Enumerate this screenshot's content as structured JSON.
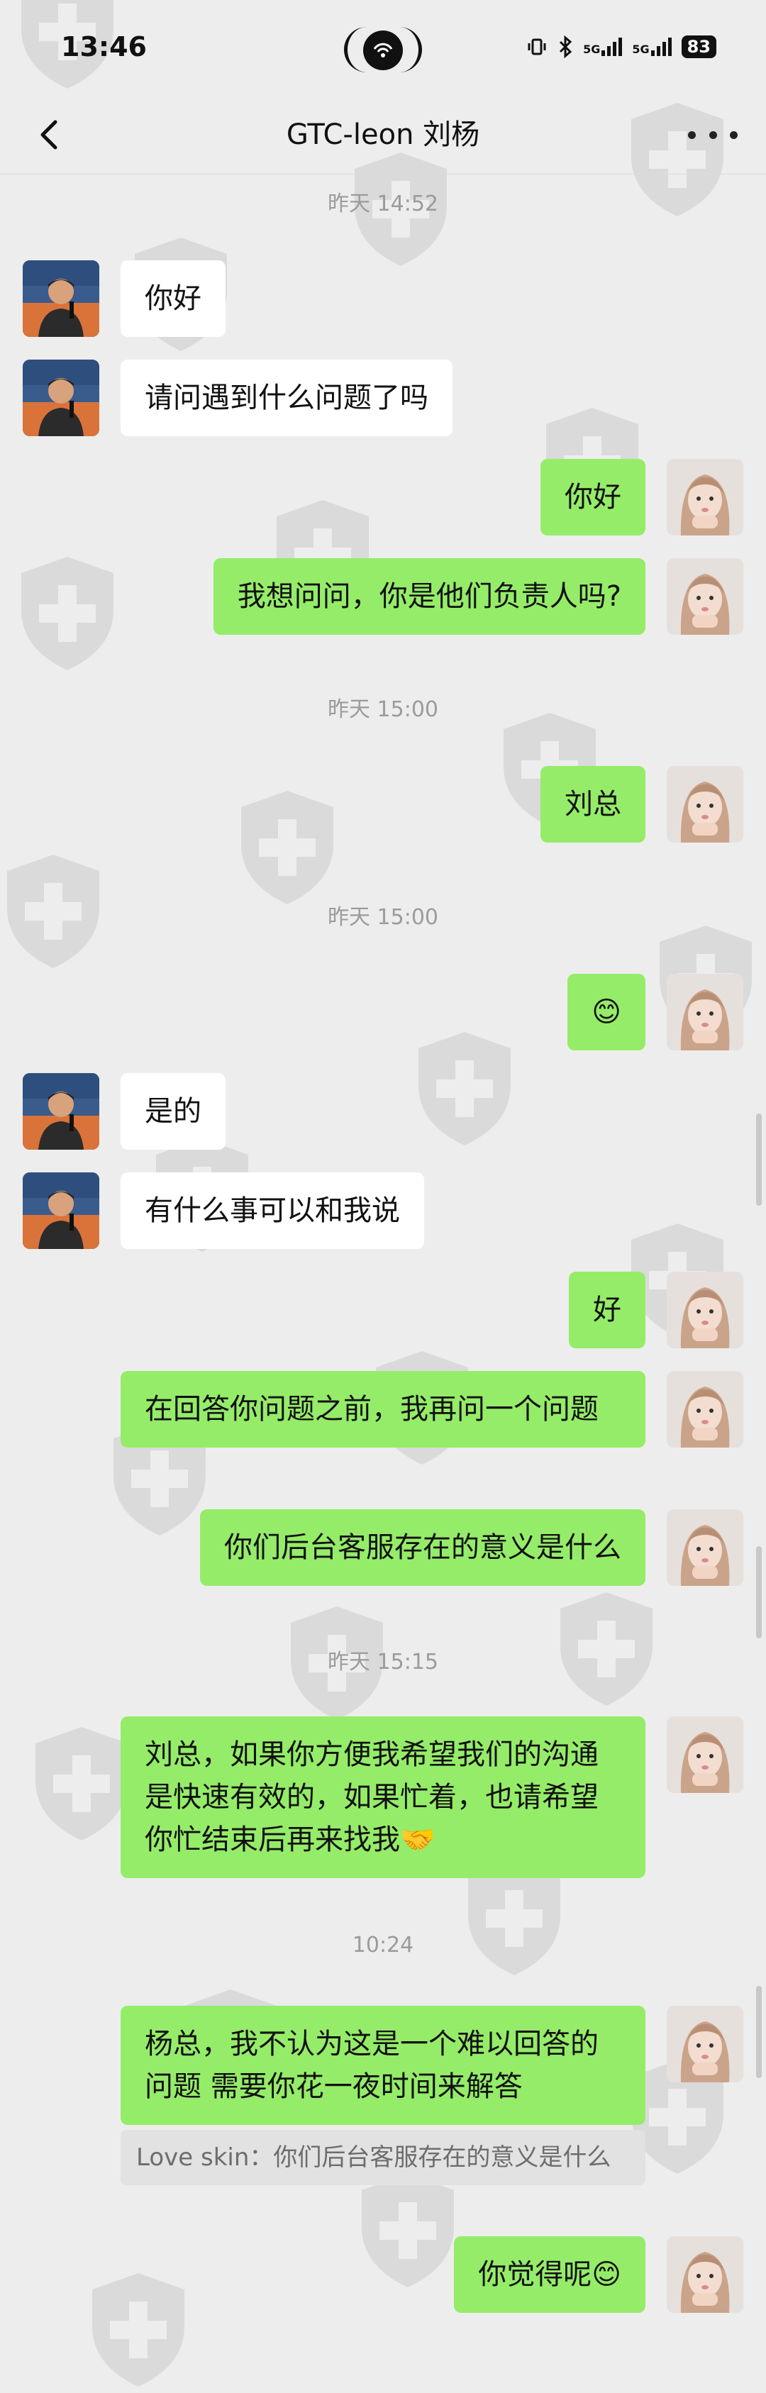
{
  "status": {
    "time": "13:46",
    "signal1": "5G",
    "signal2": "5G",
    "battery": "83"
  },
  "header": {
    "title": "GTC-leon 刘杨"
  },
  "timestamps": [
    "昨天 14:52",
    "昨天 15:00",
    "昨天 15:00",
    "昨天 15:15",
    "10:24"
  ],
  "messages": [
    {
      "side": "in",
      "text": "你好"
    },
    {
      "side": "in",
      "text": "请问遇到什么问题了吗"
    },
    {
      "side": "out",
      "text": "你好"
    },
    {
      "side": "out",
      "text": "我想问问，你是他们负责人吗?"
    },
    {
      "side": "out",
      "text": "刘总"
    },
    {
      "side": "out",
      "text": "😊"
    },
    {
      "side": "in",
      "text": "是的"
    },
    {
      "side": "in",
      "text": "有什么事可以和我说"
    },
    {
      "side": "out",
      "text": "好"
    },
    {
      "side": "out",
      "text": "在回答你问题之前，我再问一个问题"
    },
    {
      "side": "out",
      "text": "你们后台客服存在的意义是什么"
    },
    {
      "side": "out",
      "text": "刘总，如果你方便我希望我们的沟通是快速有效的，如果忙着，也请希望你忙结束后再来找我🤝"
    },
    {
      "side": "out",
      "text": "杨总，我不认为这是一个难以回答的问题  需要你花一夜时间来解答"
    },
    {
      "side": "out",
      "text": "你觉得呢😊"
    }
  ],
  "quote": {
    "text": "Love skin：你们后台客服存在的意义是什么"
  },
  "colors": {
    "outgoing": "#95ec69",
    "incoming": "#ffffff",
    "background": "#ededed"
  },
  "icons": {
    "back": "chevron-left-icon",
    "more": "more-dots-icon",
    "watermark": "shield-cross-icon"
  }
}
